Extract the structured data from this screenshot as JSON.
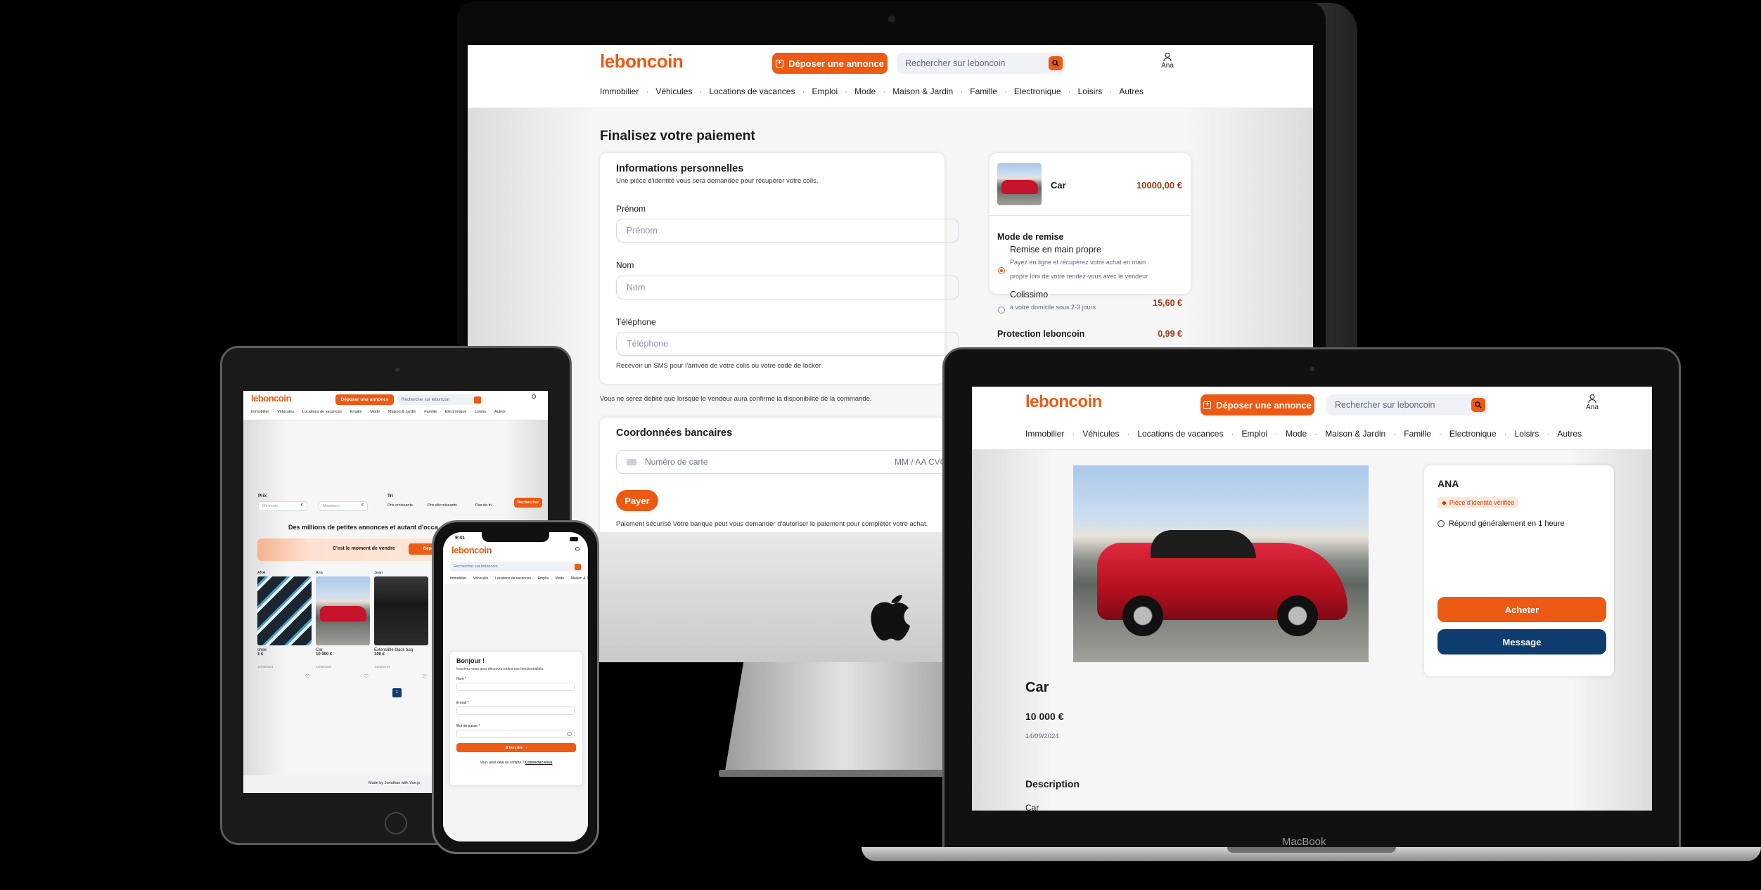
{
  "brand": {
    "logo": "leboncoin",
    "accent": "#ec5a13",
    "navy": "#0e3c6e"
  },
  "header": {
    "deposit_label": "Déposer une annonce",
    "search_placeholder": "Rechercher sur leboncoin",
    "user_name": "Ana"
  },
  "nav": [
    "Immobilier",
    "Véhicules",
    "Locations de vacances",
    "Emploi",
    "Mode",
    "Maison & Jardin",
    "Famille",
    "Electronique",
    "Loisirs",
    "Autres"
  ],
  "imac": {
    "title": "Finalisez votre paiement",
    "personal": {
      "heading": "Informations personnelles",
      "subtitle": "Une pièce d'identité vous sera demandée pour récupérer votre colis.",
      "prenom_label": "Prénom",
      "prenom_placeholder": "Prénom",
      "nom_label": "Nom",
      "nom_placeholder": "Nom",
      "tel_label": "Téléphone",
      "tel_placeholder": "Téléphone",
      "sms_note": "Recevoir un SMS pour l'arrivée de votre colis ou votre code de locker"
    },
    "debit_note": "Vous ne serez débité que lorsque le vendeur aura confirmé la disponibilité de la commande.",
    "bank": {
      "heading": "Coordonnées bancaires",
      "card_placeholder": "Numéro de carte",
      "exp_cvc": "MM / AA  CVC",
      "pay_label": "Payer",
      "secure_note": "Paiement sécurisé Votre banque peut vous demander d'autoriser le paiement pour compléter votre achat."
    },
    "summary": {
      "item_name": "Car",
      "item_price": "10000,00 €",
      "mode_heading": "Mode de remise",
      "opt1_title": "Remise en main propre",
      "opt1_desc1": "Payez en ligne et récupérez votre achat en main",
      "opt1_desc2": "propre lors de votre rendez-vous avec le vendeur",
      "opt2_title": "Colissimo",
      "opt2_desc": "à votre domicile sous 2-3 jours",
      "opt2_price": "15,60 €",
      "protection_label": "Protection leboncoin",
      "protection_price": "0,99 €"
    }
  },
  "macbook": {
    "brand_label": "MacBook",
    "seller_name": "ANA",
    "verified_badge": "Pièce d'identité vérifiée",
    "response_time": "Répond généralement en 1 heure",
    "buy_label": "Acheter",
    "message_label": "Message",
    "listing_title": "Car",
    "listing_price": "10 000 €",
    "listing_date": "14/09/2024",
    "description_heading": "Description",
    "description_text": "Car"
  },
  "ipad": {
    "filters": {
      "prix_label": "Prix",
      "tri_label": "Tri",
      "min_placeholder": "Minimum",
      "max_placeholder": "Maximum",
      "euro": "€",
      "sort_asc": "Prix croissants",
      "sort_desc": "Prix décroissants",
      "no_sort": "Pas de tri",
      "search_label": "Rechercher"
    },
    "banner_title": "Des millions de petites annonces et autant d'occa",
    "sell_cta": "C'est le moment de vendre",
    "sell_button": "Dépos",
    "listings": [
      {
        "seller": "ANA",
        "title": "shoe",
        "price": "1 €",
        "date": "14/09/2024"
      },
      {
        "seller": "Ana",
        "title": "Car",
        "price": "10 000 €",
        "date": "14/09/2024"
      },
      {
        "seller": "Jean",
        "title": "Extensible black bag",
        "price": "100 €",
        "date": "14/09/2024"
      }
    ],
    "page_number": "1",
    "footer": "Made by Jonathan with Vue.js"
  },
  "iphone": {
    "time": "9:41",
    "search_placeholder": "Rechercher sur leboncoin",
    "greeting": "Bonjour !",
    "greeting_sub": "Inscrivez-vous pour découvrir toutes nos fonctionnalités.",
    "nom_label": "Nom *",
    "email_label": "E-mail *",
    "password_label": "Mot de passe *",
    "submit_label": "S'inscrire",
    "login_prompt": "Vous avez déjà un compte ?",
    "login_link": "Connectez-vous"
  }
}
